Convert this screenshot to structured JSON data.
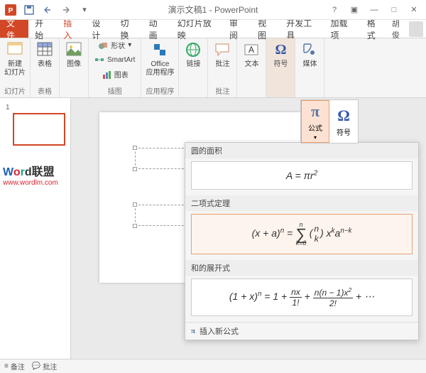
{
  "title": "演示文稿1 - PowerPoint",
  "tabs": {
    "file": "文件",
    "home": "开始",
    "insert": "插入",
    "design": "设计",
    "transitions": "切换",
    "animations": "动画",
    "slideshow": "幻灯片放映",
    "review": "审阅",
    "view": "视图",
    "developer": "开发工具",
    "addins": "加载项",
    "format": "格式"
  },
  "user": "胡俊",
  "ribbon": {
    "newslide": {
      "label": "新建\n幻灯片",
      "group": "幻灯片"
    },
    "table": {
      "label": "表格",
      "group": "表格"
    },
    "image": {
      "label": "图像"
    },
    "shapes": "形状",
    "smartart": "SmartArt",
    "chart": "图表",
    "ills_group": "插图",
    "office": {
      "label": "Office\n应用程序",
      "group": "应用程序"
    },
    "link": {
      "label": "链接"
    },
    "comment": {
      "label": "批注",
      "group": "批注"
    },
    "text": {
      "label": "文本"
    },
    "symbol": {
      "label": "符号"
    },
    "media": {
      "label": "媒体"
    }
  },
  "popup": {
    "equation": "公式",
    "symbol": "符号"
  },
  "dropdown": {
    "sect1": "圆的面积",
    "formula1": "A = πr²",
    "sect2": "二项式定理",
    "sect3": "和的展开式",
    "footer": "插入新公式"
  },
  "thumb": {
    "num": "1"
  },
  "watermark": {
    "w1": "W",
    "w2": "o",
    "w3": "r",
    "w4": "d",
    "rest": "联盟",
    "url": "www.wordlm.com"
  },
  "status": {
    "notes": "备注",
    "comments": "批注"
  }
}
